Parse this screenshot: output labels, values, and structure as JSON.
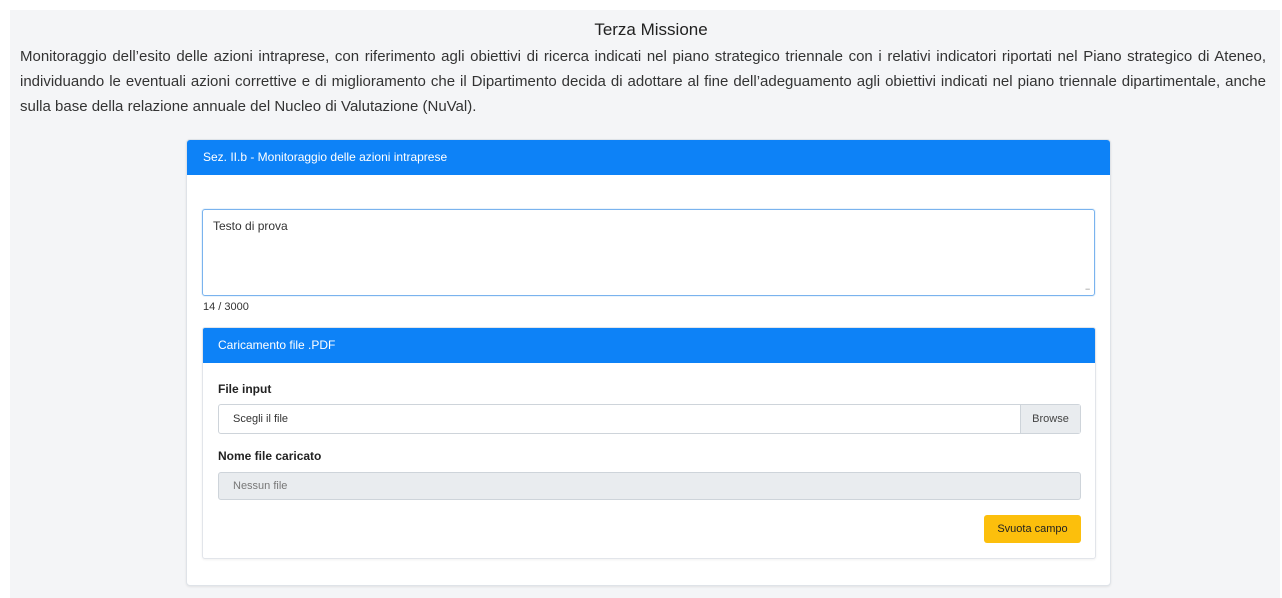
{
  "page": {
    "title": "Terza Missione",
    "intro": "Monitoraggio dell’esito delle azioni intraprese, con riferimento agli obiettivi di ricerca indicati nel piano strategico triennale con i relativi indicatori riportati nel Piano strategico di Ateneo, individuando le eventuali azioni correttive e di miglioramento che il Dipartimento decida di adottare al fine dell’adeguamento agli obiettivi indicati nel piano triennale dipartimentale, anche sulla base della relazione annuale del Nucleo di Valutazione (NuVal)."
  },
  "section": {
    "header": "Sez. II.b - Monitoraggio delle azioni intraprese",
    "textarea_value": "Testo di prova",
    "counter": "14 / 3000"
  },
  "upload": {
    "header": "Caricamento file .PDF",
    "file_label": "File input",
    "file_placeholder": "Scegli il file",
    "browse_label": "Browse",
    "loaded_label": "Nome file caricato",
    "loaded_value": "Nessun file",
    "clear_button": "Svuota campo"
  },
  "colors": {
    "primary": "#0d82f7",
    "warning": "#fcbf0c",
    "page_background": "#f4f5f7"
  }
}
